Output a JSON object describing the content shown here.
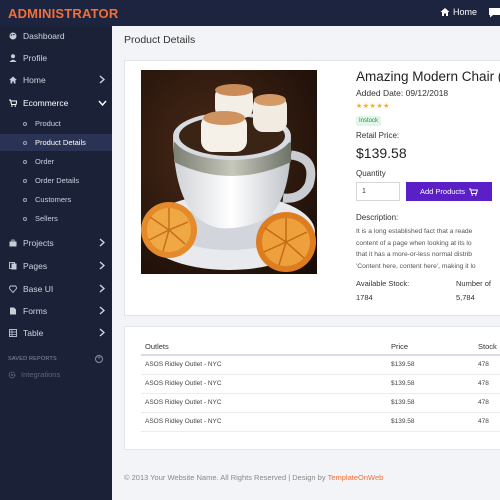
{
  "topbar": {
    "brand": "ADMINISTRATOR",
    "home_label": "Home",
    "brand_color": "#f36f37",
    "home_icon": "home-icon",
    "chat_icon": "chat-icon"
  },
  "sidebar": {
    "items": [
      {
        "label": "Dashboard",
        "icon": "palette-icon"
      },
      {
        "label": "Profile",
        "icon": "user-icon"
      },
      {
        "label": "Home",
        "icon": "home-icon"
      },
      {
        "label": "Ecommerce",
        "icon": "cart-icon"
      },
      {
        "label": "Projects",
        "icon": "briefcase-icon"
      },
      {
        "label": "Pages",
        "icon": "pages-icon"
      },
      {
        "label": "Base UI",
        "icon": "diamond-icon"
      },
      {
        "label": "Forms",
        "icon": "file-icon"
      },
      {
        "label": "Table",
        "icon": "table-icon"
      }
    ],
    "ecommerce_sub": [
      {
        "label": "Product"
      },
      {
        "label": "Product Details"
      },
      {
        "label": "Order"
      },
      {
        "label": "Order Details"
      },
      {
        "label": "Customers"
      },
      {
        "label": "Sellers"
      }
    ],
    "section_label": "SAVED REPORTS",
    "integrations_label": "Integrations"
  },
  "main": {
    "page_title": "Product Details"
  },
  "product": {
    "title": "Amazing Modern Chair (C",
    "added_date": "Added Date: 09/12/2018",
    "rating_stars": "★★★★★",
    "rating": 4.5,
    "badge": "Instock",
    "retail_label": "Retail Price:",
    "price": "$139.58",
    "quantity_label": "Quantity",
    "quantity_value": "1",
    "add_button": "Add Products",
    "description_label": "Description:",
    "description_lines": [
      "It is a long established fact that a reade",
      "content of a page when looking at its lo",
      "that it has a more-or-less normal distrib",
      "'Content here, content here', making it lo"
    ],
    "available_stock_label": "Available Stock:",
    "available_stock_value": "1784",
    "number_label": "Number of",
    "number_value": "5,784",
    "accent_color": "#5a1fc7"
  },
  "outlets_table": {
    "headers": [
      "Outlets",
      "Price",
      "Stock"
    ],
    "rows": [
      [
        "ASOS Ridley Outlet - NYC",
        "$139.58",
        "478"
      ],
      [
        "ASOS Ridley Outlet - NYC",
        "$139.58",
        "478"
      ],
      [
        "ASOS Ridley Outlet - NYC",
        "$139.58",
        "478"
      ],
      [
        "ASOS Ridley Outlet - NYC",
        "$139.58",
        "478"
      ]
    ]
  },
  "footer": {
    "text": "© 2013 Your Website Name. All Rights Reserved | Design by ",
    "link": "TemplateOnWeb"
  }
}
